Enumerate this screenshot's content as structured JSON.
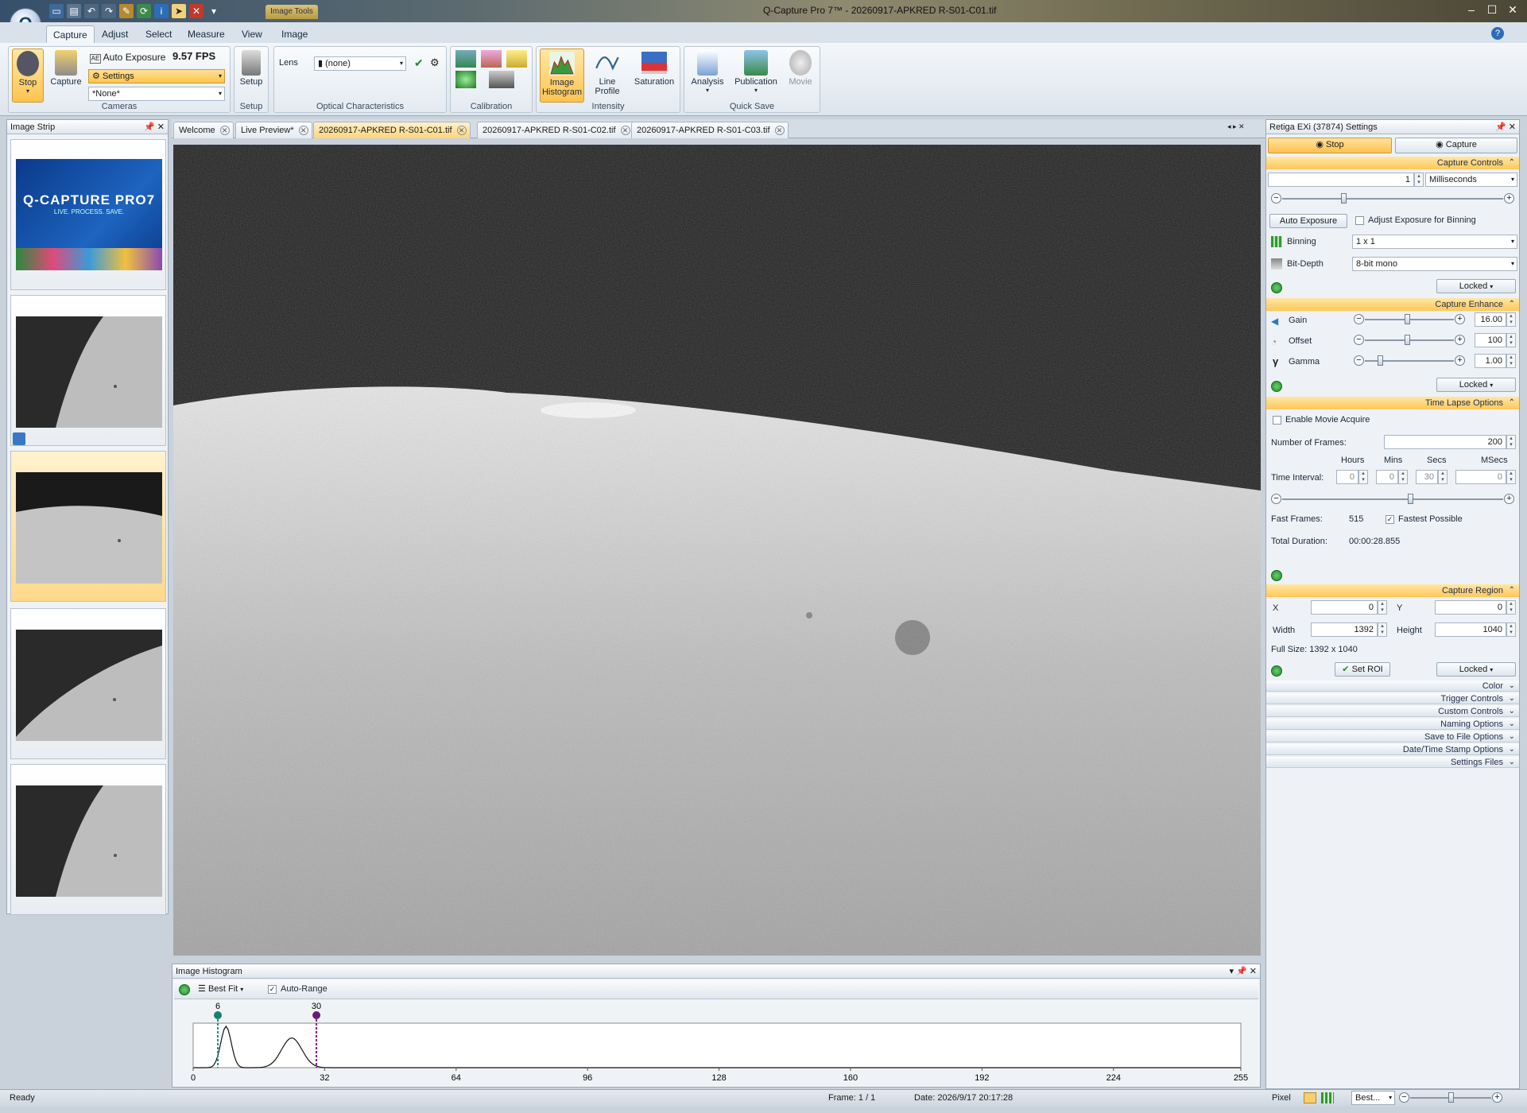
{
  "window": {
    "title": "Q-Capture Pro 7™ - 20260917-APKRED R-S01-C01.tif",
    "context_tab": "Image Tools"
  },
  "ribbon_tabs": [
    "Capture",
    "Adjust",
    "Select",
    "Measure",
    "View",
    "Image"
  ],
  "cameras_group": {
    "label": "Cameras",
    "stop_label": "Stop",
    "capture_label": "Capture",
    "auto_exposure_label": "Auto Exposure",
    "fps": "9.57 FPS",
    "settings_label": "Settings",
    "camera_select": "*None*"
  },
  "setup_group": {
    "label": "Setup",
    "setup_label": "Setup"
  },
  "optical_group": {
    "label": "Optical Characteristics",
    "lens_label": "Lens",
    "lens_value": "(none)"
  },
  "calibration_group": {
    "label": "Calibration"
  },
  "intensity_group": {
    "label": "Intensity",
    "histogram_label": "Image Histogram",
    "line_profile_label": "Line Profile",
    "saturation_label": "Saturation"
  },
  "quicksave_group": {
    "label": "Quick Save",
    "analysis_label": "Analysis",
    "publication_label": "Publication",
    "movie_label": "Movie"
  },
  "image_strip": {
    "title": "Image Strip",
    "splash_title": "Q-CAPTURE PRO7",
    "splash_sub": "LIVE. PROCESS. SAVE."
  },
  "doc_tabs": [
    {
      "label": "Welcome"
    },
    {
      "label": "Live Preview*"
    },
    {
      "label": "20260917-APKRED R-S01-C01.tif"
    },
    {
      "label": "20260917-APKRED R-S01-C02.tif"
    },
    {
      "label": "20260917-APKRED R-S01-C03.tif"
    }
  ],
  "histogram": {
    "title": "Image Histogram",
    "fit_label": "Best Fit",
    "auto_range_label": "Auto-Range",
    "auto_range_checked": true,
    "low_marker": "6",
    "high_marker": "30",
    "low_value": 6,
    "high_value": 30,
    "axis_ticks": [
      "0",
      "32",
      "64",
      "96",
      "128",
      "160",
      "192",
      "224",
      "255"
    ]
  },
  "settings": {
    "title": "Retiga EXi (37874) Settings",
    "stop_tab": "Stop",
    "capture_tab": "Capture",
    "capture_controls": {
      "header": "Capture Controls",
      "exposure_value": "1",
      "exposure_unit": "Milliseconds",
      "exposure_slider": 0.28,
      "auto_exposure_btn": "Auto Exposure",
      "adjust_binning_label": "Adjust Exposure for Binning",
      "binning_label": "Binning",
      "binning_value": "1 x 1",
      "bitdepth_label": "Bit-Depth",
      "bitdepth_value": "8-bit mono",
      "locked": "Locked"
    },
    "capture_enhance": {
      "header": "Capture Enhance",
      "gain_label": "Gain",
      "gain_value": "16.00",
      "offset_label": "Offset",
      "offset_value": "100",
      "gamma_label": "Gamma",
      "gamma_value": "1.00",
      "locked": "Locked"
    },
    "time_lapse": {
      "header": "Time Lapse Options",
      "enable_movie_label": "Enable Movie Acquire",
      "frames_label": "Number of Frames:",
      "frames_value": "200",
      "hours_label": "Hours",
      "mins_label": "Mins",
      "secs_label": "Secs",
      "msecs_label": "MSecs",
      "interval_label": "Time Interval:",
      "hours_value": "0",
      "mins_value": "0",
      "secs_value": "30",
      "msecs_value": "0",
      "fast_frames_label": "Fast Frames:",
      "fast_frames_value": "515",
      "fastest_label": "Fastest Possible",
      "total_label": "Total Duration:",
      "total_value": "00:00:28.855"
    },
    "capture_region": {
      "header": "Capture Region",
      "x_label": "X",
      "x_value": "0",
      "y_label": "Y",
      "y_value": "0",
      "width_label": "Width",
      "width_value": "1392",
      "height_label": "Height",
      "height_value": "1040",
      "full_size": "Full Size: 1392 x 1040",
      "set_roi": "Set ROI",
      "locked": "Locked"
    },
    "collapsed": [
      "Color",
      "Trigger Controls",
      "Custom Controls",
      "Naming Options",
      "Save to File Options",
      "Date/Time Stamp Options",
      "Settings Files"
    ]
  },
  "status": {
    "ready": "Ready",
    "frame": "Frame: 1 / 1",
    "date": "Date: 2026/9/17 20:17:28",
    "pixel": "Pixel",
    "zoom": "Best..."
  }
}
